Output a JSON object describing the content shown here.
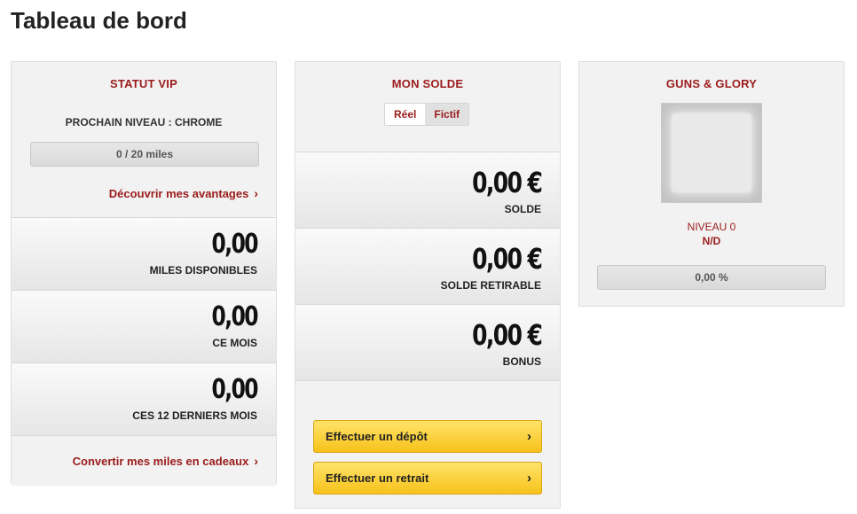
{
  "page": {
    "title": "Tableau de bord"
  },
  "vip": {
    "title": "STATUT VIP",
    "next_level": "PROCHAIN NIVEAU : CHROME",
    "progress_text": "0 / 20 miles",
    "progress_fraction": 0,
    "benefits_link": "Découvrir mes avantages",
    "stats": [
      {
        "value": "0,00",
        "label": "MILES DISPONIBLES"
      },
      {
        "value": "0,00",
        "label": "CE MOIS"
      },
      {
        "value": "0,00",
        "label": "CES 12 DERNIERS MOIS"
      }
    ],
    "convert_link": "Convertir mes miles en cadeaux"
  },
  "solde": {
    "title": "MON SOLDE",
    "tabs": [
      {
        "label": "Réel",
        "active": true
      },
      {
        "label": "Fictif",
        "active": false
      }
    ],
    "stats": [
      {
        "value": "0,00 €",
        "label": "SOLDE"
      },
      {
        "value": "0,00 €",
        "label": "SOLDE RETIRABLE"
      },
      {
        "value": "0,00 €",
        "label": "BONUS"
      }
    ],
    "deposit_button": "Effectuer un dépôt",
    "withdraw_button": "Effectuer un retrait"
  },
  "guns": {
    "title": "GUNS & GLORY",
    "level": "NIVEAU 0",
    "status": "N/D",
    "progress_text": "0,00 %",
    "progress_fraction": 0
  },
  "icons": {
    "chevron": "chevron-right-icon"
  },
  "colors": {
    "accent": "#9b1b1b",
    "button": "#f7c21a",
    "card": "#f2f2f2"
  }
}
